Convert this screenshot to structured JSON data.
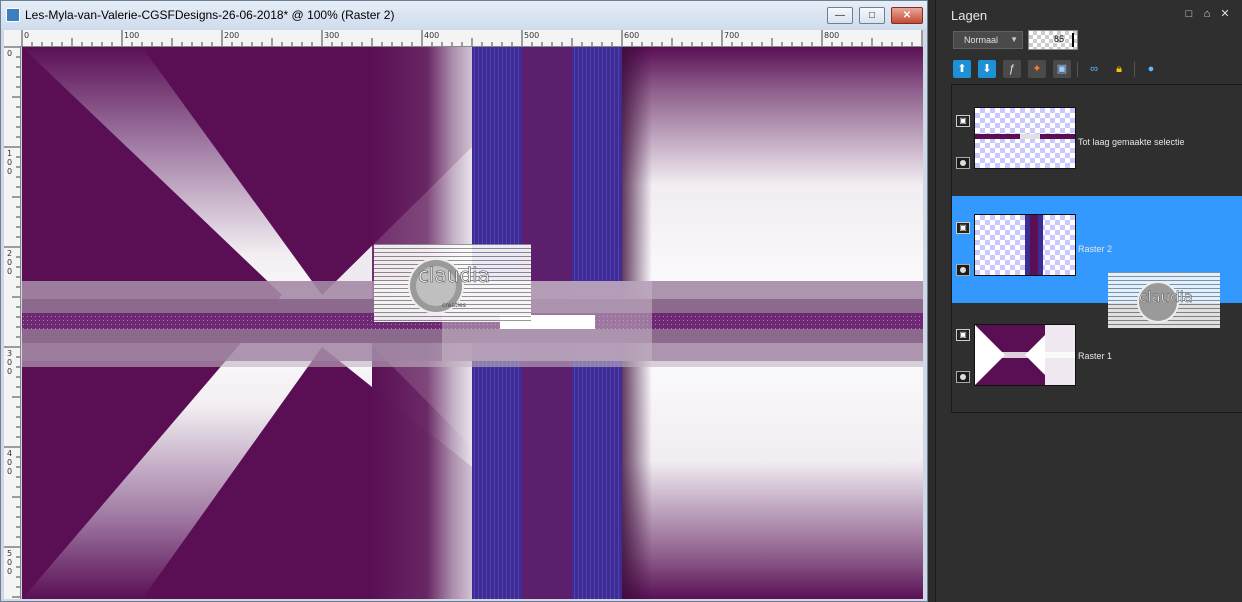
{
  "window": {
    "title": "Les-Myla-van-Valerie-CGSFDesigns-26-06-2018* @ 100% (Raster 2)",
    "controls": {
      "minimize": "—",
      "maximize": "□",
      "close": "✕"
    }
  },
  "ruler": {
    "top_labels": [
      "0",
      "100",
      "200",
      "300",
      "400",
      "500",
      "600",
      "700",
      "800"
    ],
    "left_labels": [
      "0",
      "1\n0\n0",
      "2\n0\n0",
      "3\n0\n0",
      "4\n0\n0",
      "5\n0\n0"
    ]
  },
  "watermark": {
    "text": "claudia",
    "subtext": "creaties"
  },
  "layers_panel": {
    "title": "Lagen",
    "blend_mode": "Normaal",
    "opacity": "85",
    "toolbar_icons": [
      "new-raster-layer-icon",
      "new-vector-layer-icon",
      "new-adjustment-layer-icon",
      "effects-icon",
      "mask-icon",
      "link-icon",
      "lock-icon",
      "delete-icon"
    ],
    "layers": [
      {
        "name": "Tot laag gemaakte selectie",
        "selected": false
      },
      {
        "name": "Raster 2",
        "selected": true
      },
      {
        "name": "Raster 1",
        "selected": false
      }
    ]
  },
  "colors": {
    "accent_selection": "#3399ff",
    "canvas_purple": "#5a0f55",
    "stripe_blue": "#3c2d95"
  }
}
